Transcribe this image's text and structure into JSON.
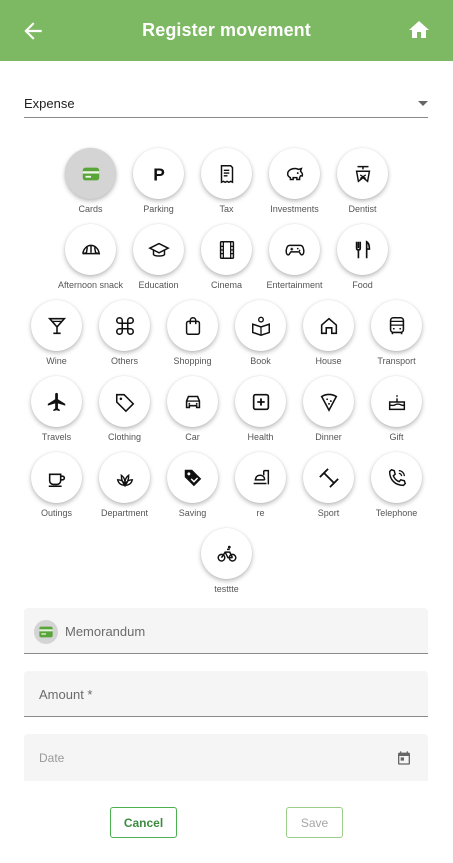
{
  "header": {
    "title": "Register movement"
  },
  "movement_type": {
    "value": "Expense"
  },
  "categories": [
    [
      {
        "label": "Cards",
        "icon": "card-icon",
        "selected": true
      },
      {
        "label": "Parking",
        "icon": "parking-icon"
      },
      {
        "label": "Tax",
        "icon": "receipt-icon"
      },
      {
        "label": "Investments",
        "icon": "piggy-bank-icon"
      },
      {
        "label": "Dentist",
        "icon": "tooth-icon"
      }
    ],
    [
      {
        "label": "Afternoon snack",
        "icon": "croissant-icon"
      },
      {
        "label": "Education",
        "icon": "graduation-cap-icon"
      },
      {
        "label": "Cinema",
        "icon": "film-icon"
      },
      {
        "label": "Entertainment",
        "icon": "gamepad-icon"
      },
      {
        "label": "Food",
        "icon": "cutlery-icon"
      }
    ],
    [
      {
        "label": "Wine",
        "icon": "cocktail-icon"
      },
      {
        "label": "Others",
        "icon": "command-icon"
      },
      {
        "label": "Shopping",
        "icon": "shopping-bag-icon"
      },
      {
        "label": "Book",
        "icon": "book-reader-icon"
      },
      {
        "label": "House",
        "icon": "house-icon"
      },
      {
        "label": "Transport",
        "icon": "bus-icon"
      }
    ],
    [
      {
        "label": "Travels",
        "icon": "airplane-icon"
      },
      {
        "label": "Clothing",
        "icon": "tag-icon"
      },
      {
        "label": "Car",
        "icon": "car-icon"
      },
      {
        "label": "Health",
        "icon": "medical-cross-icon"
      },
      {
        "label": "Dinner",
        "icon": "pizza-icon"
      },
      {
        "label": "Gift",
        "icon": "cake-icon"
      }
    ],
    [
      {
        "label": "Outings",
        "icon": "coffee-cup-icon"
      },
      {
        "label": "Department",
        "icon": "plant-icon"
      },
      {
        "label": "Saving",
        "icon": "price-tag-icon"
      },
      {
        "label": "re",
        "icon": "takeaway-icon"
      },
      {
        "label": "Sport",
        "icon": "dumbbell-icon"
      },
      {
        "label": "Telephone",
        "icon": "phone-icon"
      }
    ],
    [
      {
        "label": "testtte",
        "icon": "bicycle-icon"
      }
    ]
  ],
  "memorandum": {
    "placeholder": "Memorandum",
    "icon": "card-icon"
  },
  "amount": {
    "placeholder": "Amount *"
  },
  "date": {
    "placeholder": "Date"
  },
  "actions": {
    "cancel": "Cancel",
    "save": "Save"
  },
  "colors": {
    "primary": "#7db862",
    "accent_button": "#4caf50",
    "card_icon": "#5aa53a"
  }
}
